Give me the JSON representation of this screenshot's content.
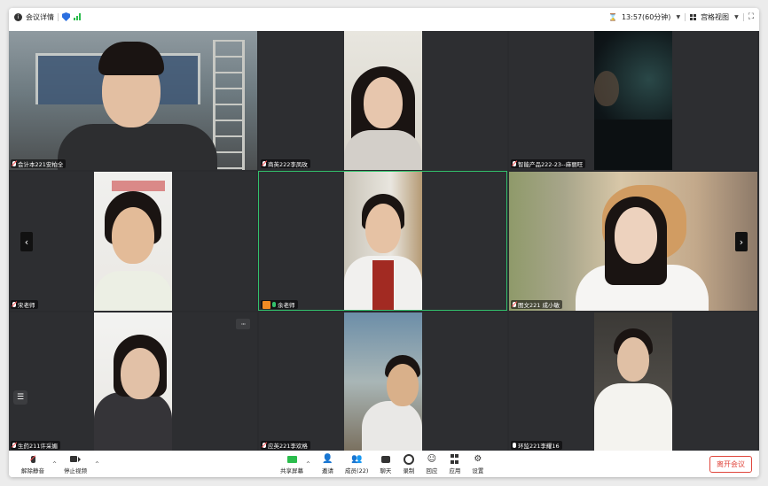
{
  "topbar": {
    "meeting_info_label": "会议详情",
    "timer": "13:57(60分钟)",
    "view_label": "宫格视图",
    "icons": [
      "info-icon",
      "shield-icon",
      "signal-icon",
      "hourglass-icon",
      "grid-view-icon",
      "fullscreen-icon"
    ]
  },
  "participants": [
    {
      "name": "会计本221安柏全",
      "mic": "muted"
    },
    {
      "name": "商英222李凤玫",
      "mic": "muted"
    },
    {
      "name": "智能产品222-23--麻丽旺",
      "mic": "muted"
    },
    {
      "name": "宋老师",
      "mic": "muted"
    },
    {
      "name": "余老师",
      "mic": "on",
      "speaking": true
    },
    {
      "name": "图文221 成小敏",
      "mic": "muted"
    },
    {
      "name": "生药211许采媚",
      "mic": "muted"
    },
    {
      "name": "应英221李欢格",
      "mic": "muted"
    },
    {
      "name": "环监221李耀16",
      "mic": "on"
    }
  ],
  "nav": {
    "prev": "‹",
    "next": "›",
    "more": "···"
  },
  "toolbar": {
    "unmute_label": "解除静音",
    "stop_video_label": "停止视频",
    "share_label": "共享屏幕",
    "invite_label": "邀请",
    "members_label": "成员(22)",
    "chat_label": "聊天",
    "record_label": "录制",
    "reaction_label": "回应",
    "apps_label": "应用",
    "settings_label": "设置",
    "leave_label": "离开会议"
  },
  "colors": {
    "active_speaker": "#32c16c",
    "leave": "#e0463c",
    "tile_bg": "#2d2e31"
  }
}
